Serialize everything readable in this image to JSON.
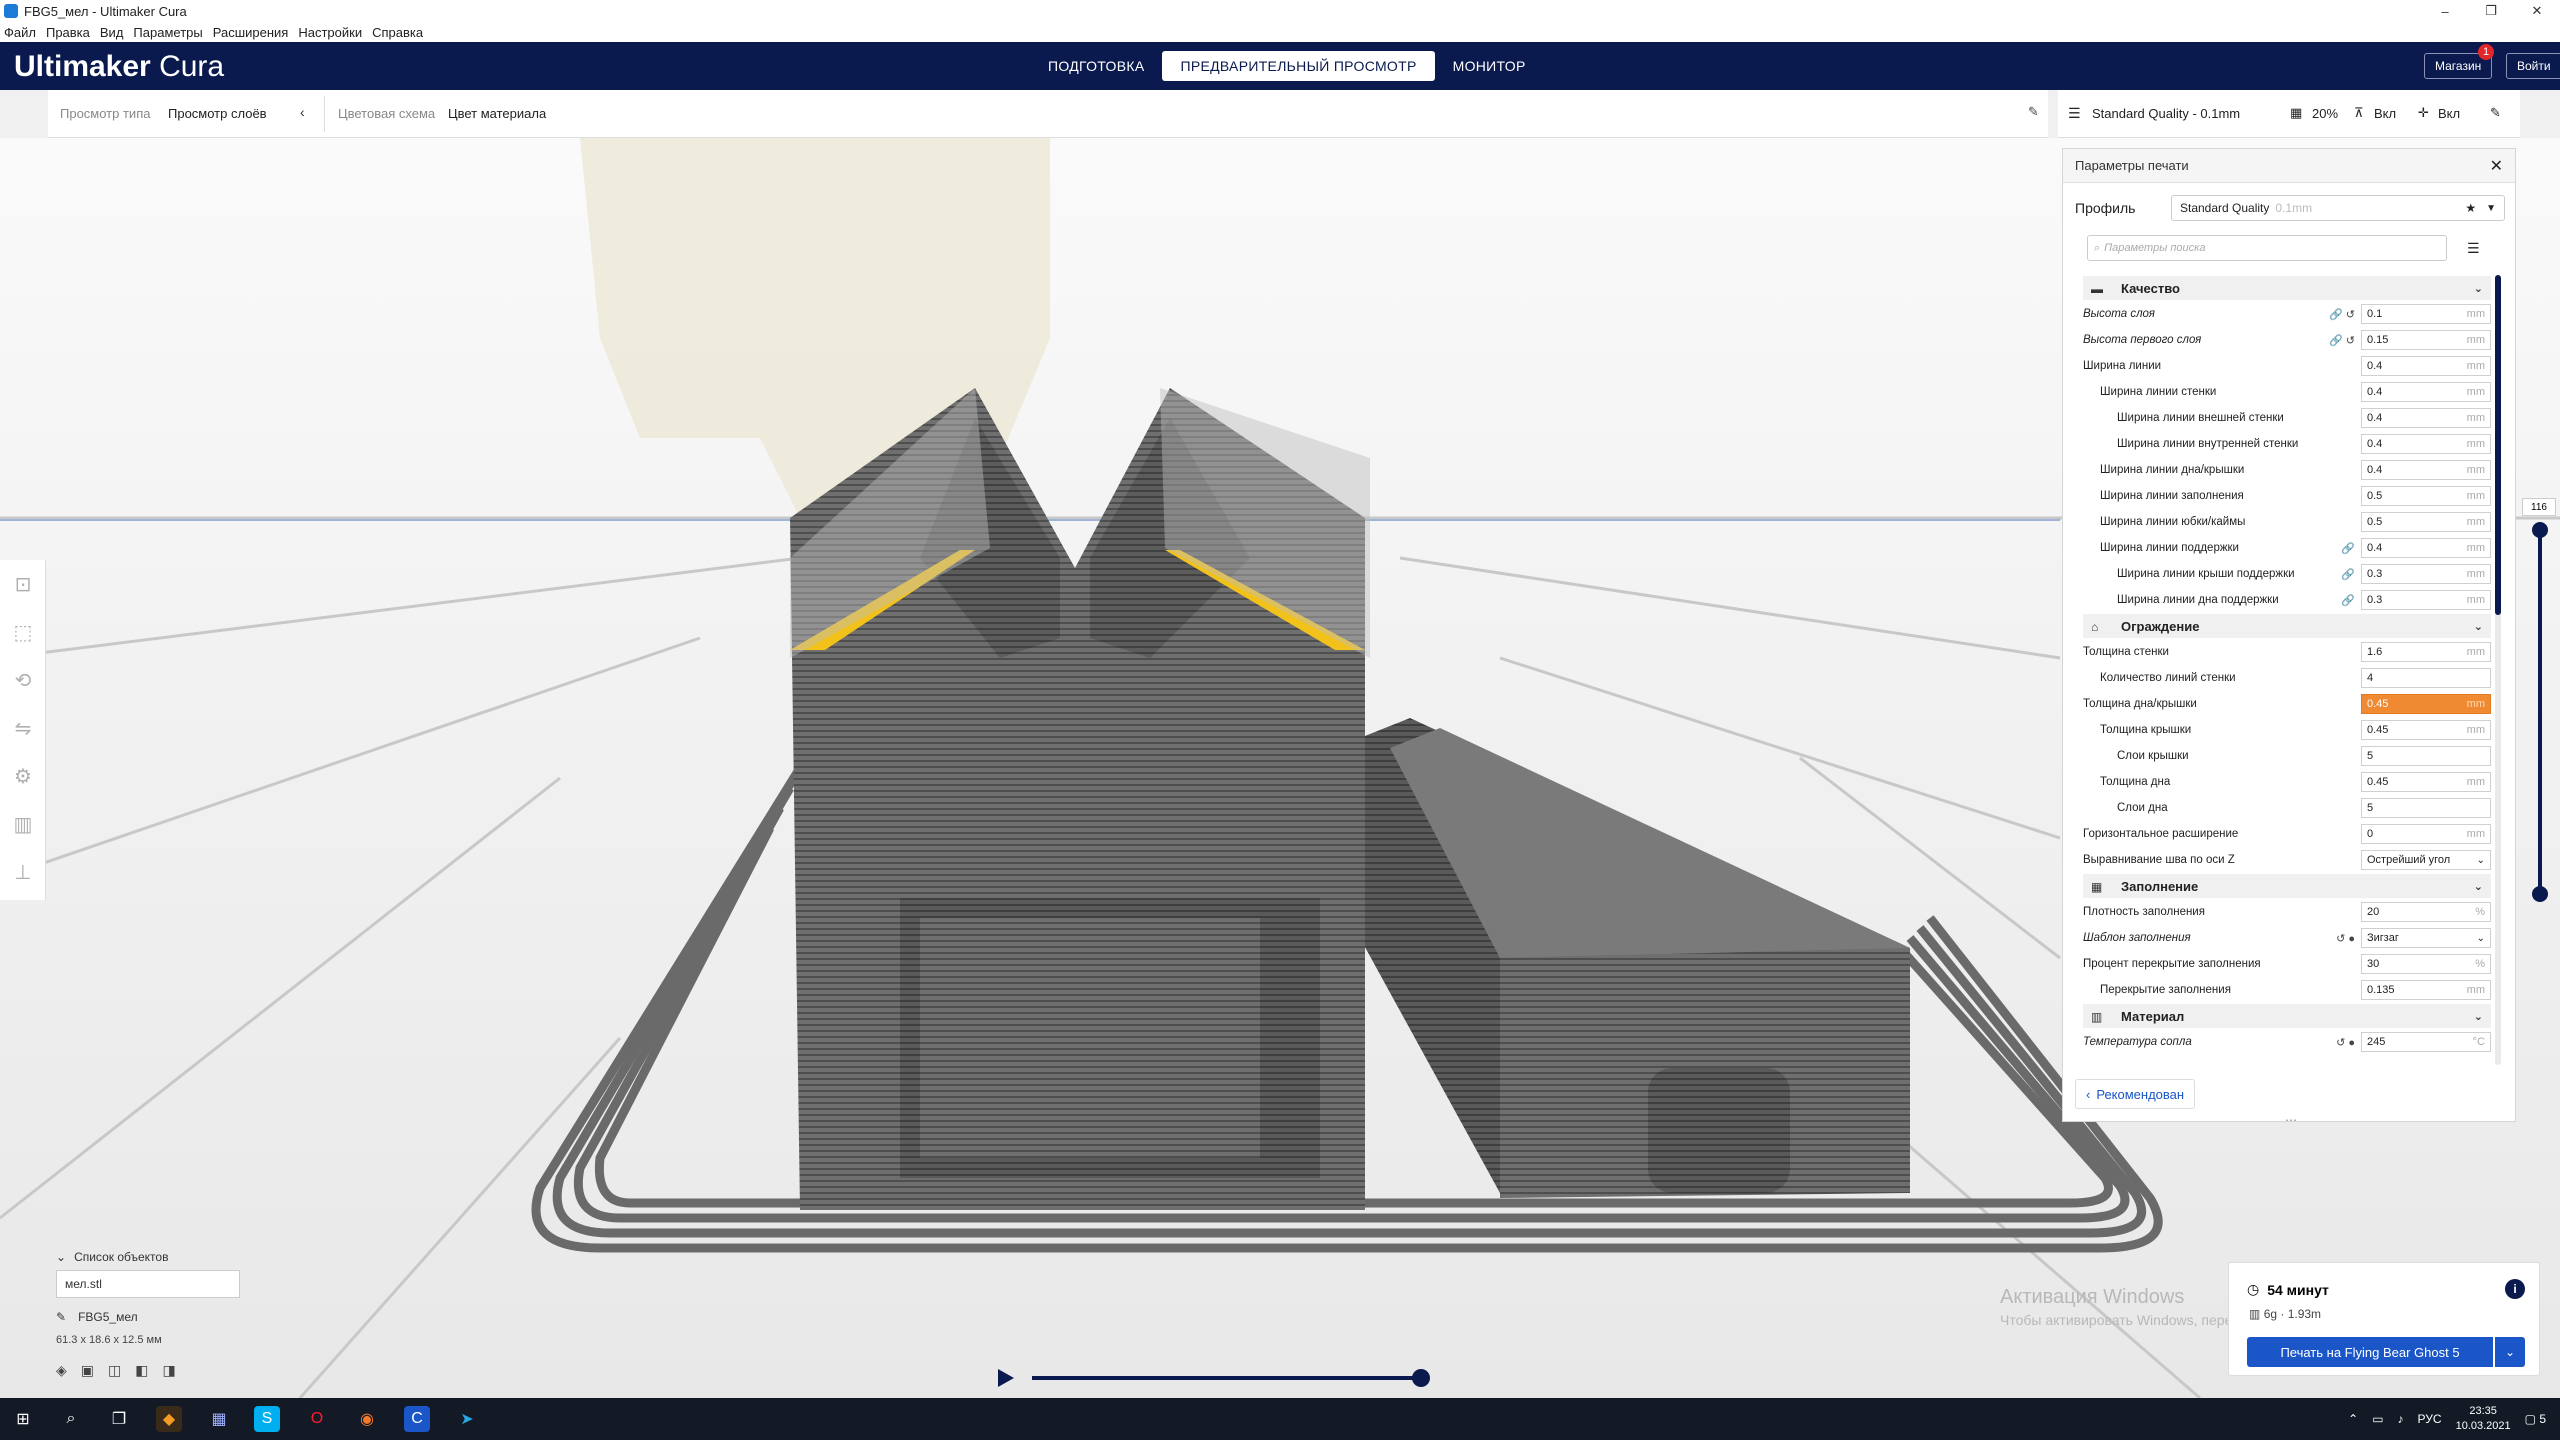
{
  "window": {
    "title": "FBG5_мел - Ultimaker Cura",
    "controls": [
      "–",
      "❐",
      "✕"
    ]
  },
  "menu": [
    "Файл",
    "Правка",
    "Вид",
    "Параметры",
    "Расширения",
    "Настройки",
    "Справка"
  ],
  "header": {
    "logo_bold": "Ultimaker",
    "logo_light": " Cura",
    "stages": [
      "ПОДГОТОВКА",
      "ПРЕДВАРИТЕЛЬНЫЙ ПРОСМОТР",
      "МОНИТОР"
    ],
    "active_stage": 1,
    "marketplace": "Магазин",
    "marketplace_badge": "1",
    "login": "Войти"
  },
  "toolbar": {
    "view_type_label": "Просмотр типа",
    "view_type_value": "Просмотр слоёв",
    "color_scheme_label": "Цветовая схема",
    "color_scheme_value": "Цвет материала"
  },
  "print_setup_bar": {
    "profile": "Standard Quality - 0.1mm",
    "infill": "20%",
    "support": "Вкл",
    "adhesion": "Вкл"
  },
  "panel": {
    "title": "Параметры печати",
    "profile_label": "Профиль",
    "profile_value": "Standard Quality",
    "profile_suffix": "0.1mm",
    "search_placeholder": "Параметры поиска",
    "footer_button": "Рекомендован",
    "categories": [
      {
        "title": "Качество",
        "rows": [
          {
            "name": "Высота слоя",
            "italic": true,
            "indent": 0,
            "icons": "🔗 ↺",
            "value": "0.1",
            "unit": "mm"
          },
          {
            "name": "Высота первого слоя",
            "italic": true,
            "indent": 0,
            "icons": "🔗 ↺",
            "value": "0.15",
            "unit": "mm"
          },
          {
            "name": "Ширина линии",
            "italic": false,
            "indent": 0,
            "icons": "",
            "value": "0.4",
            "unit": "mm"
          },
          {
            "name": "Ширина линии стенки",
            "italic": false,
            "indent": 1,
            "icons": "",
            "value": "0.4",
            "unit": "mm"
          },
          {
            "name": "Ширина линии внешней стенки",
            "italic": false,
            "indent": 2,
            "icons": "",
            "value": "0.4",
            "unit": "mm"
          },
          {
            "name": "Ширина линии внутренней стенки",
            "italic": false,
            "indent": 2,
            "icons": "",
            "value": "0.4",
            "unit": "mm"
          },
          {
            "name": "Ширина линии дна/крышки",
            "italic": false,
            "indent": 1,
            "icons": "",
            "value": "0.4",
            "unit": "mm"
          },
          {
            "name": "Ширина линии заполнения",
            "italic": false,
            "indent": 1,
            "icons": "",
            "value": "0.5",
            "unit": "mm"
          },
          {
            "name": "Ширина линии юбки/каймы",
            "italic": false,
            "indent": 1,
            "icons": "",
            "value": "0.5",
            "unit": "mm"
          },
          {
            "name": "Ширина линии поддержки",
            "italic": false,
            "indent": 1,
            "icons": "🔗",
            "value": "0.4",
            "unit": "mm"
          },
          {
            "name": "Ширина линии крыши поддержки",
            "italic": false,
            "indent": 2,
            "icons": "🔗",
            "value": "0.3",
            "unit": "mm"
          },
          {
            "name": "Ширина линии дна поддержки",
            "italic": false,
            "indent": 2,
            "icons": "🔗",
            "value": "0.3",
            "unit": "mm"
          }
        ]
      },
      {
        "title": "Ограждение",
        "rows": [
          {
            "name": "Толщина стенки",
            "italic": false,
            "indent": 0,
            "icons": "",
            "value": "1.6",
            "unit": "mm"
          },
          {
            "name": "Количество линий стенки",
            "italic": false,
            "indent": 1,
            "icons": "",
            "value": "4",
            "unit": ""
          },
          {
            "name": "Толщина дна/крышки",
            "italic": false,
            "indent": 0,
            "icons": "",
            "value": "0.45",
            "unit": "mm",
            "error": true
          },
          {
            "name": "Толщина крышки",
            "italic": false,
            "indent": 1,
            "icons": "",
            "value": "0.45",
            "unit": "mm"
          },
          {
            "name": "Слои крышки",
            "italic": false,
            "indent": 2,
            "icons": "",
            "value": "5",
            "unit": ""
          },
          {
            "name": "Толщина дна",
            "italic": false,
            "indent": 1,
            "icons": "",
            "value": "0.45",
            "unit": "mm"
          },
          {
            "name": "Слои дна",
            "italic": false,
            "indent": 2,
            "icons": "",
            "value": "5",
            "unit": ""
          },
          {
            "name": "Горизонтальное расширение",
            "italic": false,
            "indent": 0,
            "icons": "",
            "value": "0",
            "unit": "mm"
          },
          {
            "name": "Выравнивание шва по оси Z",
            "italic": false,
            "indent": 0,
            "icons": "",
            "value": "Острейший угол",
            "unit": "",
            "dropdown": true
          }
        ]
      },
      {
        "title": "Заполнение",
        "rows": [
          {
            "name": "Плотность заполнения",
            "italic": false,
            "indent": 0,
            "icons": "",
            "value": "20",
            "unit": "%"
          },
          {
            "name": "Шаблон заполнения",
            "italic": true,
            "indent": 0,
            "icons": "↺ ●",
            "value": "Зигзаг",
            "unit": "",
            "dropdown": true
          },
          {
            "name": "Процент перекрытие заполнения",
            "italic": false,
            "indent": 0,
            "icons": "",
            "value": "30",
            "unit": "%"
          },
          {
            "name": "Перекрытие заполнения",
            "italic": false,
            "indent": 1,
            "icons": "",
            "value": "0.135",
            "unit": "mm"
          }
        ]
      },
      {
        "title": "Материал",
        "rows": [
          {
            "name": "Температура сопла",
            "italic": true,
            "indent": 0,
            "icons": "↺ ●",
            "value": "245",
            "unit": "°C"
          }
        ]
      }
    ]
  },
  "layer_slider": {
    "value": "116"
  },
  "object_list": {
    "title": "Список объектов",
    "filter_value": "мел.stl",
    "object_name": "FBG5_мел",
    "dimensions": "61.3 x 18.6 x 12.5 мм"
  },
  "watermark": {
    "line1": "Активация Windows",
    "line2": "Чтобы активировать Windows, перейдите в раздел \"Параметры\"."
  },
  "action_panel": {
    "time": "54 минут",
    "material": "6g · 1.93m",
    "print_button": "Печать на Flying Bear Ghost 5",
    "info": "i"
  },
  "taskbar": {
    "lang": "РУС",
    "time": "23:35",
    "date": "10.03.2021",
    "notif_count": "5"
  },
  "colors": {
    "header_bg": "#0b1a4e",
    "primary_button": "#1b56c8",
    "error_field": "#f08a32",
    "model_grey": "#6a6a6a",
    "top_layer_yellow": "#f2c21b"
  }
}
